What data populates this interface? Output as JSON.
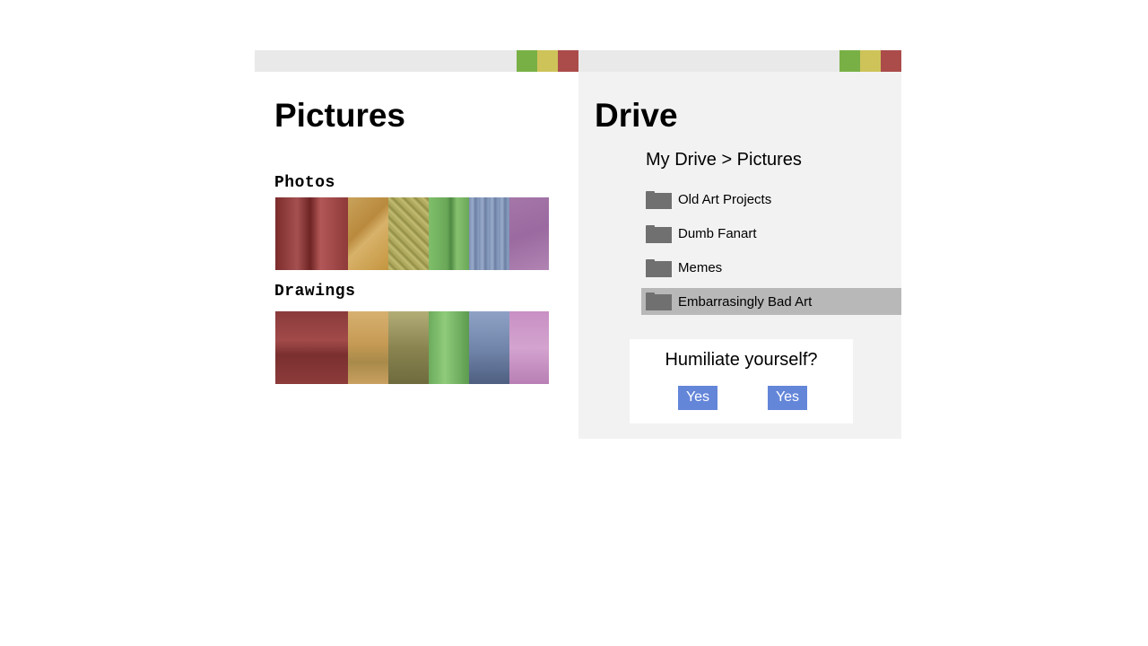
{
  "colors": {
    "maximize": "#79b046",
    "minimize": "#cdc359",
    "close": "#ab4c4b",
    "titlebar": "#e9e9e9",
    "drive_bg": "#f2f2f2",
    "selected_row": "#b8b8b8",
    "button": "#6486d9",
    "folder": "#707070"
  },
  "pictures_window": {
    "title": "Pictures",
    "sections": [
      {
        "heading": "Photos",
        "tints": [
          "red",
          "orange",
          "yellow",
          "green",
          "blue",
          "purple"
        ]
      },
      {
        "heading": "Drawings",
        "tints": [
          "red",
          "orange",
          "olive",
          "green",
          "blue",
          "pink"
        ]
      }
    ]
  },
  "drive_window": {
    "title": "Drive",
    "breadcrumb": "My Drive > Pictures",
    "folders": [
      {
        "label": "Old Art Projects",
        "selected": false
      },
      {
        "label": "Dumb Fanart",
        "selected": false
      },
      {
        "label": "Memes",
        "selected": false
      },
      {
        "label": "Embarrasingly Bad Art",
        "selected": true
      }
    ],
    "dialog": {
      "message": "Humiliate yourself?",
      "button_1": "Yes",
      "button_2": "Yes"
    }
  }
}
